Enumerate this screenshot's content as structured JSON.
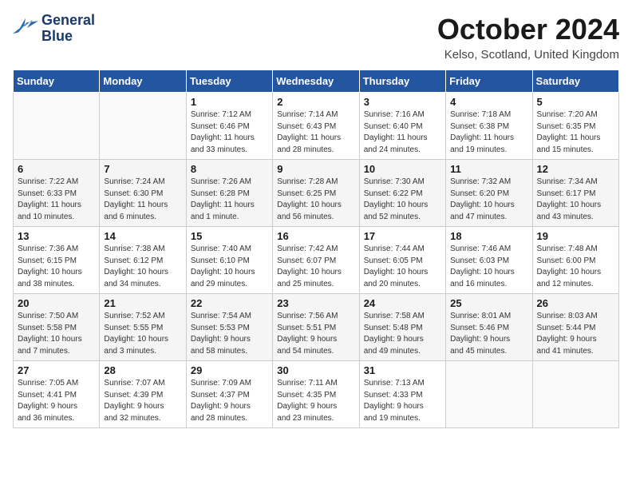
{
  "logo": {
    "line1": "General",
    "line2": "Blue"
  },
  "title": "October 2024",
  "location": "Kelso, Scotland, United Kingdom",
  "weekdays": [
    "Sunday",
    "Monday",
    "Tuesday",
    "Wednesday",
    "Thursday",
    "Friday",
    "Saturday"
  ],
  "weeks": [
    [
      {
        "day": "",
        "info": ""
      },
      {
        "day": "",
        "info": ""
      },
      {
        "day": "1",
        "info": "Sunrise: 7:12 AM\nSunset: 6:46 PM\nDaylight: 11 hours\nand 33 minutes."
      },
      {
        "day": "2",
        "info": "Sunrise: 7:14 AM\nSunset: 6:43 PM\nDaylight: 11 hours\nand 28 minutes."
      },
      {
        "day": "3",
        "info": "Sunrise: 7:16 AM\nSunset: 6:40 PM\nDaylight: 11 hours\nand 24 minutes."
      },
      {
        "day": "4",
        "info": "Sunrise: 7:18 AM\nSunset: 6:38 PM\nDaylight: 11 hours\nand 19 minutes."
      },
      {
        "day": "5",
        "info": "Sunrise: 7:20 AM\nSunset: 6:35 PM\nDaylight: 11 hours\nand 15 minutes."
      }
    ],
    [
      {
        "day": "6",
        "info": "Sunrise: 7:22 AM\nSunset: 6:33 PM\nDaylight: 11 hours\nand 10 minutes."
      },
      {
        "day": "7",
        "info": "Sunrise: 7:24 AM\nSunset: 6:30 PM\nDaylight: 11 hours\nand 6 minutes."
      },
      {
        "day": "8",
        "info": "Sunrise: 7:26 AM\nSunset: 6:28 PM\nDaylight: 11 hours\nand 1 minute."
      },
      {
        "day": "9",
        "info": "Sunrise: 7:28 AM\nSunset: 6:25 PM\nDaylight: 10 hours\nand 56 minutes."
      },
      {
        "day": "10",
        "info": "Sunrise: 7:30 AM\nSunset: 6:22 PM\nDaylight: 10 hours\nand 52 minutes."
      },
      {
        "day": "11",
        "info": "Sunrise: 7:32 AM\nSunset: 6:20 PM\nDaylight: 10 hours\nand 47 minutes."
      },
      {
        "day": "12",
        "info": "Sunrise: 7:34 AM\nSunset: 6:17 PM\nDaylight: 10 hours\nand 43 minutes."
      }
    ],
    [
      {
        "day": "13",
        "info": "Sunrise: 7:36 AM\nSunset: 6:15 PM\nDaylight: 10 hours\nand 38 minutes."
      },
      {
        "day": "14",
        "info": "Sunrise: 7:38 AM\nSunset: 6:12 PM\nDaylight: 10 hours\nand 34 minutes."
      },
      {
        "day": "15",
        "info": "Sunrise: 7:40 AM\nSunset: 6:10 PM\nDaylight: 10 hours\nand 29 minutes."
      },
      {
        "day": "16",
        "info": "Sunrise: 7:42 AM\nSunset: 6:07 PM\nDaylight: 10 hours\nand 25 minutes."
      },
      {
        "day": "17",
        "info": "Sunrise: 7:44 AM\nSunset: 6:05 PM\nDaylight: 10 hours\nand 20 minutes."
      },
      {
        "day": "18",
        "info": "Sunrise: 7:46 AM\nSunset: 6:03 PM\nDaylight: 10 hours\nand 16 minutes."
      },
      {
        "day": "19",
        "info": "Sunrise: 7:48 AM\nSunset: 6:00 PM\nDaylight: 10 hours\nand 12 minutes."
      }
    ],
    [
      {
        "day": "20",
        "info": "Sunrise: 7:50 AM\nSunset: 5:58 PM\nDaylight: 10 hours\nand 7 minutes."
      },
      {
        "day": "21",
        "info": "Sunrise: 7:52 AM\nSunset: 5:55 PM\nDaylight: 10 hours\nand 3 minutes."
      },
      {
        "day": "22",
        "info": "Sunrise: 7:54 AM\nSunset: 5:53 PM\nDaylight: 9 hours\nand 58 minutes."
      },
      {
        "day": "23",
        "info": "Sunrise: 7:56 AM\nSunset: 5:51 PM\nDaylight: 9 hours\nand 54 minutes."
      },
      {
        "day": "24",
        "info": "Sunrise: 7:58 AM\nSunset: 5:48 PM\nDaylight: 9 hours\nand 49 minutes."
      },
      {
        "day": "25",
        "info": "Sunrise: 8:01 AM\nSunset: 5:46 PM\nDaylight: 9 hours\nand 45 minutes."
      },
      {
        "day": "26",
        "info": "Sunrise: 8:03 AM\nSunset: 5:44 PM\nDaylight: 9 hours\nand 41 minutes."
      }
    ],
    [
      {
        "day": "27",
        "info": "Sunrise: 7:05 AM\nSunset: 4:41 PM\nDaylight: 9 hours\nand 36 minutes."
      },
      {
        "day": "28",
        "info": "Sunrise: 7:07 AM\nSunset: 4:39 PM\nDaylight: 9 hours\nand 32 minutes."
      },
      {
        "day": "29",
        "info": "Sunrise: 7:09 AM\nSunset: 4:37 PM\nDaylight: 9 hours\nand 28 minutes."
      },
      {
        "day": "30",
        "info": "Sunrise: 7:11 AM\nSunset: 4:35 PM\nDaylight: 9 hours\nand 23 minutes."
      },
      {
        "day": "31",
        "info": "Sunrise: 7:13 AM\nSunset: 4:33 PM\nDaylight: 9 hours\nand 19 minutes."
      },
      {
        "day": "",
        "info": ""
      },
      {
        "day": "",
        "info": ""
      }
    ]
  ]
}
